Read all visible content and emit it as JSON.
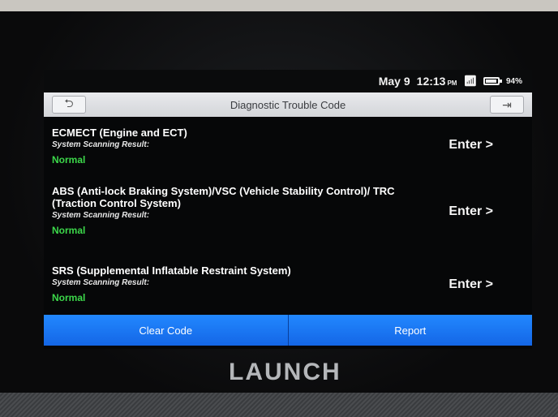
{
  "status_bar": {
    "date": "May 9",
    "time": "12:13",
    "ampm": "PM",
    "wifi_icon": "wifi-icon",
    "battery_level": 0.94,
    "battery_text": "94%"
  },
  "title_bar": {
    "title": "Diagnostic Trouble Code",
    "back_icon": "back-arrow-icon",
    "exit_icon": "exit-icon"
  },
  "systems": [
    {
      "name": "ECMECT (Engine and ECT)",
      "result_label": "System Scanning Result:",
      "result": "Normal",
      "action": "Enter >"
    },
    {
      "name": "ABS (Anti-lock Braking System)/VSC (Vehicle Stability Control)/ TRC (Traction Control System)",
      "result_label": "System Scanning Result:",
      "result": "Normal",
      "action": "Enter >"
    },
    {
      "name": "SRS (Supplemental Inflatable Restraint System)",
      "result_label": "System Scanning Result:",
      "result": "Normal",
      "action": "Enter >"
    }
  ],
  "bottom_bar": {
    "clear_label": "Clear Code",
    "report_label": "Report"
  },
  "brand": "LAUNCH",
  "colors": {
    "normal_status": "#3cd84a",
    "action_button": "#1a7bff"
  }
}
